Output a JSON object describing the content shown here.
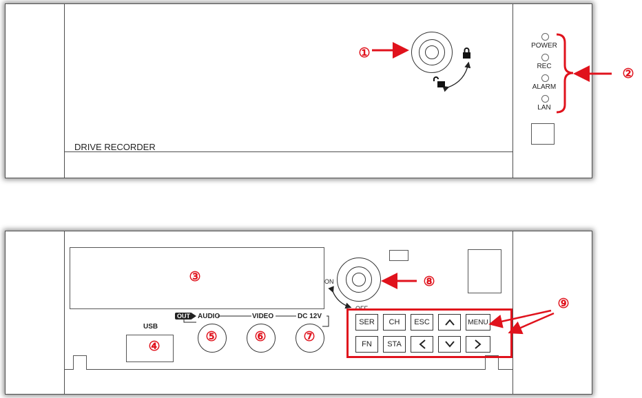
{
  "top_panel": {
    "brand_label": "DRIVE RECORDER",
    "callouts": [
      "①",
      "②"
    ],
    "leds": [
      {
        "label": "POWER"
      },
      {
        "label": "REC"
      },
      {
        "label": "ALARM"
      },
      {
        "label": "LAN"
      }
    ],
    "icons": [
      "key-lock-icon",
      "padlock-locked-icon",
      "padlock-unlocked-icon"
    ]
  },
  "bottom_panel": {
    "callouts": {
      "display": "③",
      "usb": "④",
      "audio": "⑤",
      "video": "⑥",
      "dc": "⑦",
      "power_key": "⑧",
      "keypad": "⑨"
    },
    "usb_label": "USB",
    "out_label": "OUT",
    "audio_label": "AUDIO",
    "video_label": "VIDEO",
    "dc_label": "DC 12V",
    "on_label": "ON",
    "off_label": "OFF",
    "keys_row1": [
      "SER",
      "CH",
      "ESC",
      "^",
      "MENU"
    ],
    "keys_row2": [
      "FN",
      "STA",
      "<",
      "v",
      ">"
    ]
  },
  "colors": {
    "callout": "#e0121c",
    "outline": "#4d4d4d"
  }
}
